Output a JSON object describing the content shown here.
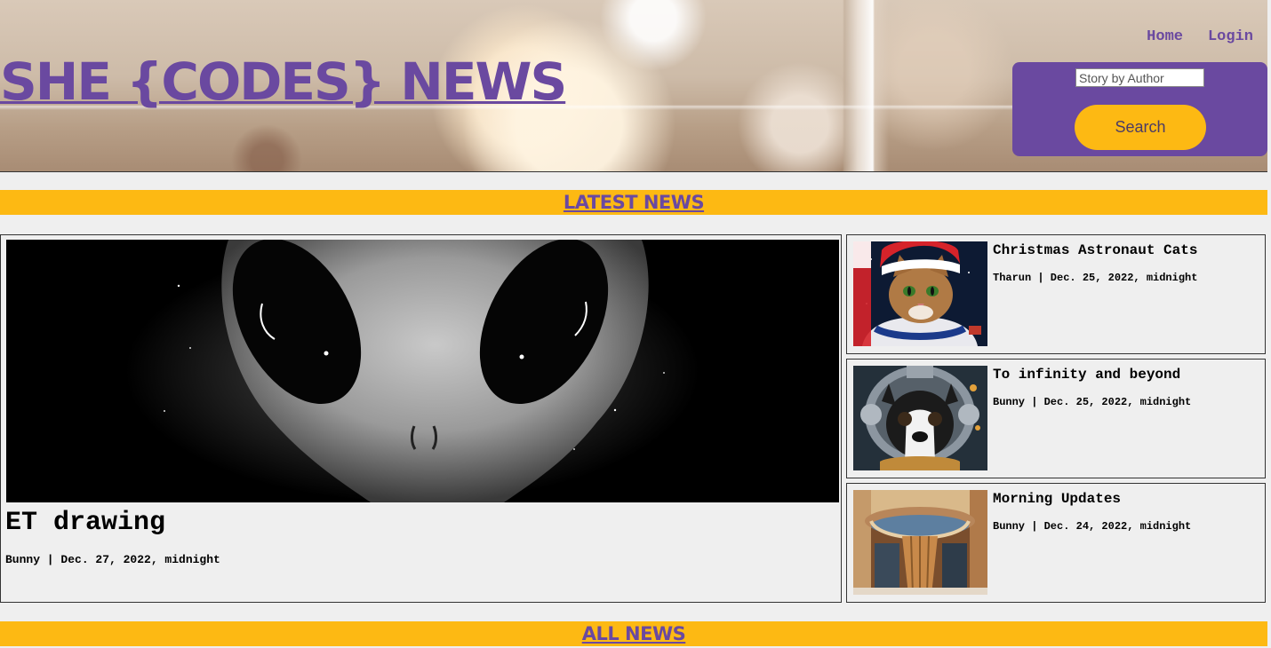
{
  "header": {
    "site_title": "SHE {CODES} NEWS",
    "nav": [
      {
        "label": "Home"
      },
      {
        "label": "Login"
      }
    ],
    "search": {
      "placeholder": "Story by Author",
      "value": "",
      "button_label": "Search"
    }
  },
  "sections": {
    "latest_title": "LATEST NEWS",
    "all_title": "ALL NEWS"
  },
  "featured_story": {
    "title": "ET drawing",
    "author": "Bunny",
    "date": "Dec. 27, 2022, midnight",
    "meta": "Bunny | Dec. 27, 2022, midnight",
    "image": "alien-face-image"
  },
  "side_stories": [
    {
      "title": "Christmas Astronaut Cats",
      "author": "Tharun",
      "date": "Dec. 25, 2022, midnight",
      "meta": "Tharun | Dec. 25, 2022, midnight",
      "image": "astronaut-cat-santa-hat-image"
    },
    {
      "title": "To infinity and beyond",
      "author": "Bunny",
      "date": "Dec. 25, 2022, midnight",
      "meta": "Bunny | Dec. 25, 2022, midnight",
      "image": "astronaut-dog-helmet-image"
    },
    {
      "title": "Morning Updates",
      "author": "Bunny",
      "date": "Dec. 24, 2022, midnight",
      "meta": "Bunny | Dec. 24, 2022, midnight",
      "image": "ornate-theater-entrance-image"
    }
  ],
  "colors": {
    "brand_purple": "#6a49a0",
    "accent_yellow": "#fdb913",
    "page_background": "#efefef"
  }
}
